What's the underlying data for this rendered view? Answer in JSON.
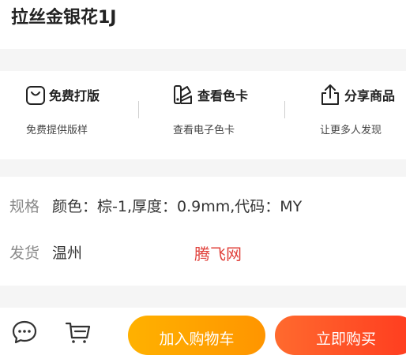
{
  "product": {
    "title": "拉丝金银花1J"
  },
  "services": [
    {
      "title": "免费打版",
      "subtitle": "免费提供版样",
      "icon": "bag-icon"
    },
    {
      "title": "查看色卡",
      "subtitle": "查看电子色卡",
      "icon": "color-card-icon"
    },
    {
      "title": "分享商品",
      "subtitle": "让更多人发现",
      "icon": "share-icon"
    }
  ],
  "specs": {
    "spec_label": "规格",
    "spec_value": "颜色：棕-1,厚度：0.9mm,代码：MY",
    "ship_label": "发货",
    "ship_value": "温州"
  },
  "watermark": "腾飞网",
  "bottom_bar": {
    "add_to_cart": "加入购物车",
    "buy_now": "立即购买"
  },
  "colors": {
    "accent_orange": "#ff9f00",
    "accent_red": "#ff4422",
    "watermark_red": "#e0403a"
  }
}
